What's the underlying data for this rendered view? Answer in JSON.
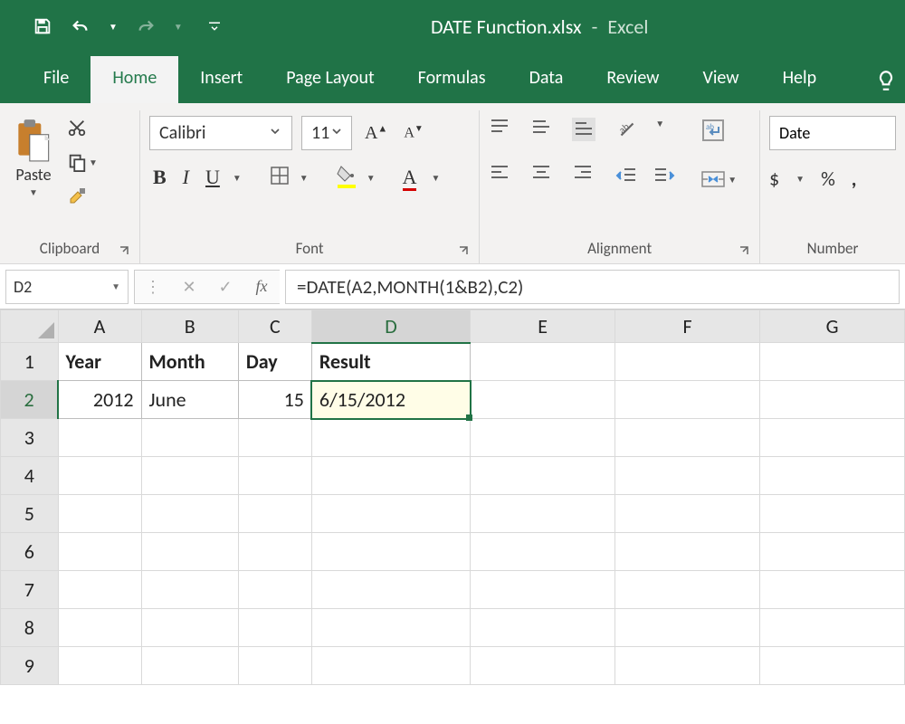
{
  "titlebar": {
    "filename": "DATE Function.xlsx",
    "app": "Excel"
  },
  "tabs": {
    "file": "File",
    "home": "Home",
    "insert": "Insert",
    "page_layout": "Page Layout",
    "formulas": "Formulas",
    "data": "Data",
    "review": "Review",
    "view": "View",
    "help": "Help"
  },
  "ribbon": {
    "clipboard": {
      "paste": "Paste",
      "label": "Clipboard"
    },
    "font": {
      "name_value": "Calibri",
      "size_value": "11",
      "label": "Font"
    },
    "alignment": {
      "label": "Alignment"
    },
    "number": {
      "label": "Number",
      "format_value": "Date",
      "currency": "$",
      "percent": "%",
      "comma": ","
    }
  },
  "formula_bar": {
    "cell_ref": "D2",
    "formula": "=DATE(A2,MONTH(1&B2),C2)"
  },
  "columns": [
    "A",
    "B",
    "C",
    "D",
    "E",
    "F",
    "G"
  ],
  "rows": [
    "1",
    "2",
    "3",
    "4",
    "5",
    "6",
    "7",
    "8",
    "9"
  ],
  "cells": {
    "A1": "Year",
    "B1": "Month",
    "C1": "Day",
    "D1": "Result",
    "A2": "2012",
    "B2": "June",
    "C2": "15",
    "D2": "6/15/2012"
  }
}
